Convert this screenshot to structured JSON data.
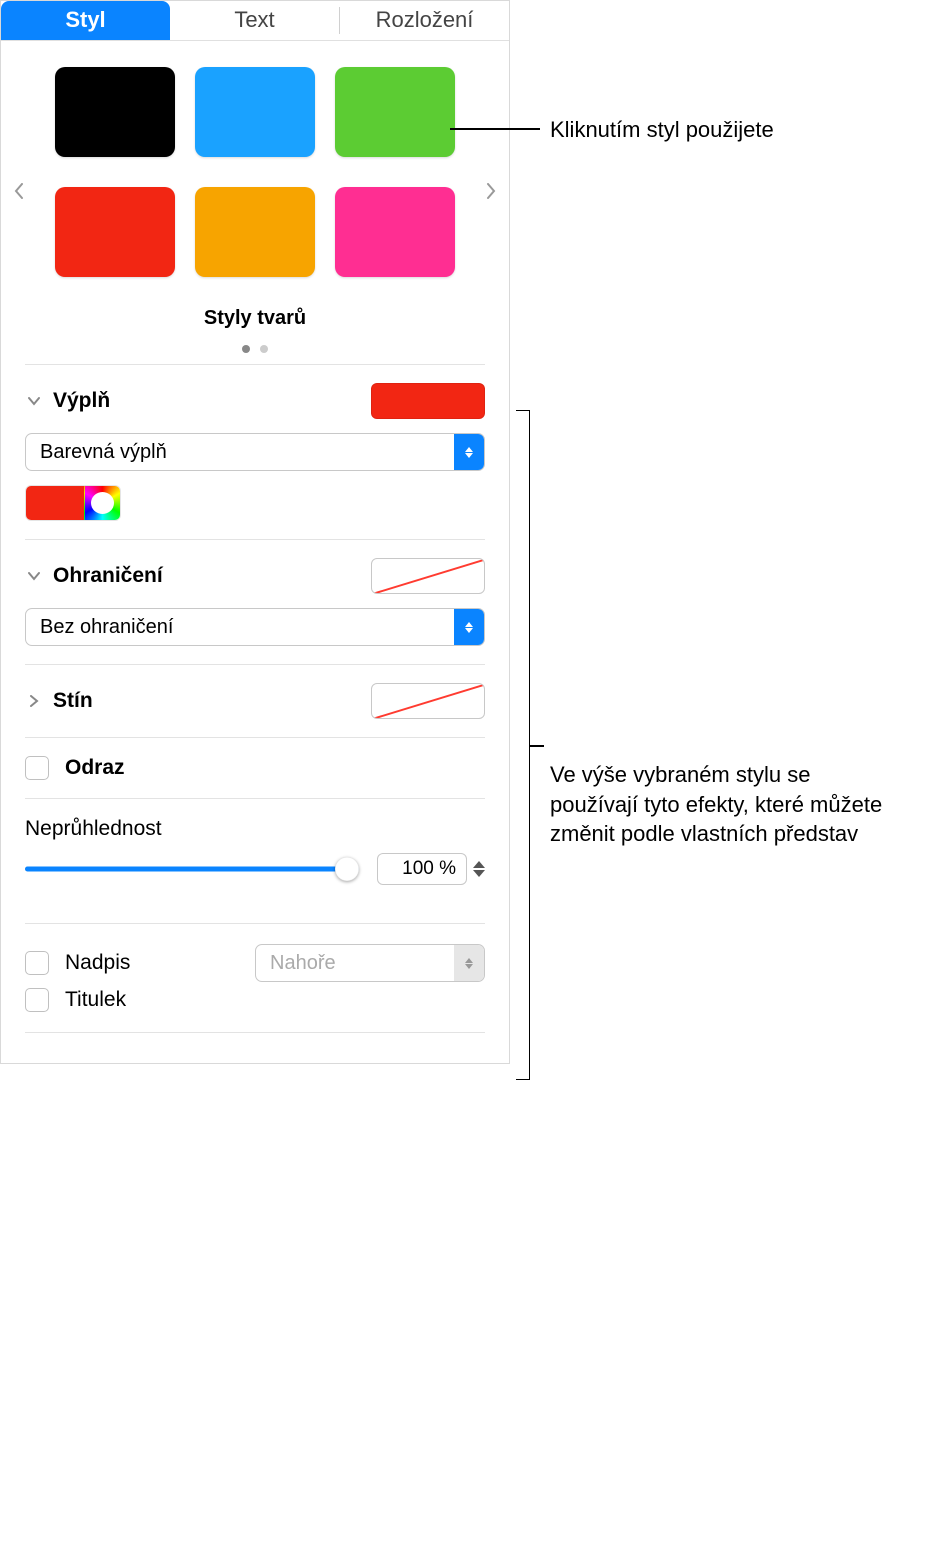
{
  "tabs": {
    "style": "Styl",
    "text": "Text",
    "layout": "Rozložení"
  },
  "swatches": {
    "label": "Styly tvarů",
    "colors": [
      "#000000",
      "#1aa2ff",
      "#5ccc33",
      "#f22613",
      "#f7a400",
      "#ff2e92"
    ]
  },
  "fill": {
    "label": "Výplň",
    "type": "Barevná výplň",
    "color": "#f22613"
  },
  "border": {
    "label": "Ohraničení",
    "type": "Bez ohraničení"
  },
  "shadow": {
    "label": "Stín"
  },
  "reflection": {
    "label": "Odraz"
  },
  "opacity": {
    "label": "Neprůhlednost",
    "value": "100 %"
  },
  "title": {
    "label": "Nadpis",
    "position": "Nahoře"
  },
  "caption": {
    "label": "Titulek"
  },
  "callouts": {
    "top": "Kliknutím styl použijete",
    "middle": "Ve výše vybraném stylu se používají tyto efekty, které můžete změnit podle vlastních představ"
  }
}
